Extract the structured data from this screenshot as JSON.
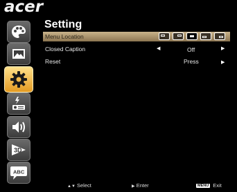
{
  "logo": "acer",
  "page": {
    "title": "Setting"
  },
  "sidebar": {
    "items": [
      {
        "name": "color-icon"
      },
      {
        "name": "image-icon"
      },
      {
        "name": "setting-icon",
        "active": true
      },
      {
        "name": "management-icon"
      },
      {
        "name": "audio-icon"
      },
      {
        "name": "3d-icon",
        "label": "3D"
      },
      {
        "name": "language-icon",
        "label": "ABC"
      }
    ]
  },
  "menu": {
    "rows": [
      {
        "label": "Menu Location",
        "selected": true
      },
      {
        "label": "Closed Caption",
        "value": "Off",
        "left_arrow": "◀",
        "right_arrow": "▶"
      },
      {
        "label": "Reset",
        "value": "Press",
        "right_arrow": "▶"
      }
    ],
    "location_options": [
      "top-left",
      "top-right",
      "center",
      "bottom-left",
      "bottom-right"
    ],
    "location_selected": "center"
  },
  "footer": {
    "select_arrows": "▲▼",
    "select": "Select",
    "enter_arrow": "▶",
    "enter": "Enter",
    "menu_key": "MENU",
    "exit": "Exit"
  },
  "colors": {
    "highlight": "#c9b38b",
    "active_icon": "#f0b848",
    "background": "#000000"
  }
}
